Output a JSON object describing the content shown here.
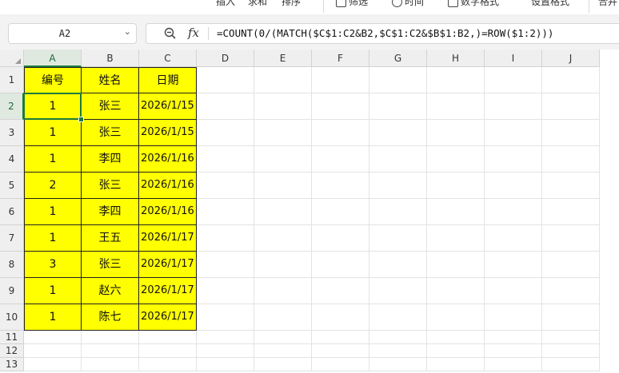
{
  "ribbon": {
    "items": [
      "插入",
      "求和",
      "排序",
      "筛选",
      "时间",
      "数字格式",
      "设置格式",
      "合并"
    ]
  },
  "formula_bar": {
    "name_box": "A2",
    "fx_label": "fx",
    "formula": "=COUNT(0/(MATCH($C$1:C2&B2,$C$1:C2&$B$1:B2,)=ROW($1:2)))"
  },
  "columns": [
    "A",
    "B",
    "C",
    "D",
    "E",
    "F",
    "G",
    "H",
    "I",
    "J"
  ],
  "rows": [
    "1",
    "2",
    "3",
    "4",
    "5",
    "6",
    "7",
    "8",
    "9",
    "10",
    "11",
    "12",
    "13"
  ],
  "active_cell": {
    "column": "A",
    "row": "2"
  },
  "table": {
    "headers": [
      "编号",
      "姓名",
      "日期"
    ],
    "data": [
      [
        "1",
        "张三",
        "2026/1/15"
      ],
      [
        "1",
        "张三",
        "2026/1/15"
      ],
      [
        "1",
        "李四",
        "2026/1/16"
      ],
      [
        "2",
        "张三",
        "2026/1/16"
      ],
      [
        "1",
        "李四",
        "2026/1/16"
      ],
      [
        "1",
        "王五",
        "2026/1/17"
      ],
      [
        "3",
        "张三",
        "2026/1/17"
      ],
      [
        "1",
        "赵六",
        "2026/1/17"
      ],
      [
        "1",
        "陈七",
        "2026/1/17"
      ]
    ]
  },
  "colors": {
    "fill": "#ffff00",
    "selection": "#1e7a3c",
    "header_bg": "#efefef"
  }
}
